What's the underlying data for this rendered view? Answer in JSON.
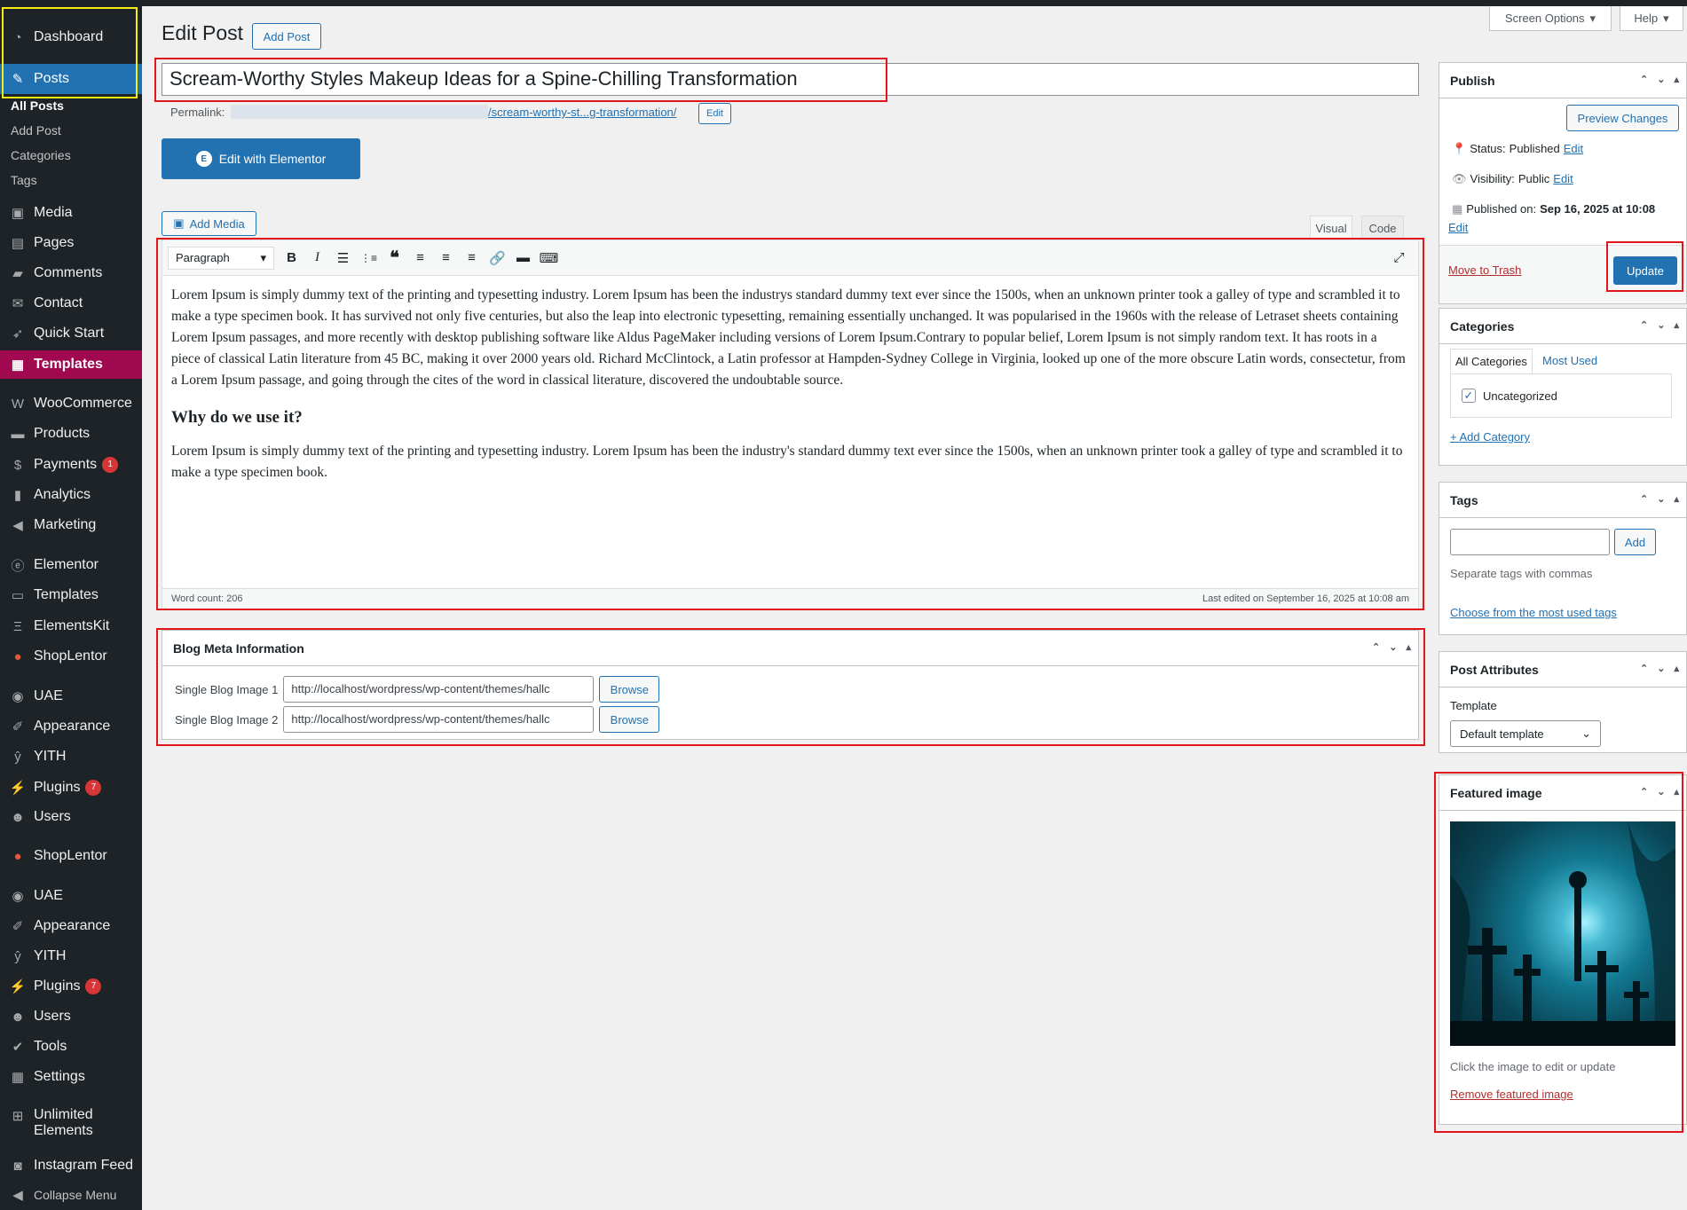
{
  "sidebar": {
    "items": [
      {
        "label": "Dashboard",
        "icon": "dashboard-icon"
      },
      {
        "label": "Posts",
        "icon": "pin-icon"
      },
      {
        "label": "Media",
        "icon": "media-icon"
      },
      {
        "label": "Pages",
        "icon": "pages-icon"
      },
      {
        "label": "Comments",
        "icon": "comments-icon"
      },
      {
        "label": "Contact",
        "icon": "mail-icon"
      },
      {
        "label": "Quick Start",
        "icon": "rocket-icon"
      },
      {
        "label": "Templates",
        "icon": "templates-icon"
      },
      {
        "label": "WooCommerce",
        "icon": "woo-icon"
      },
      {
        "label": "Products",
        "icon": "products-icon"
      },
      {
        "label": "Payments",
        "icon": "payments-icon",
        "badge": "1"
      },
      {
        "label": "Analytics",
        "icon": "chart-icon"
      },
      {
        "label": "Marketing",
        "icon": "megaphone-icon"
      },
      {
        "label": "Elementor",
        "icon": "elementor-icon"
      },
      {
        "label": "Templates",
        "icon": "folder-icon"
      },
      {
        "label": "ElementsKit",
        "icon": "ekit-icon"
      },
      {
        "label": "ShopLentor",
        "icon": "shoplentor-icon"
      },
      {
        "label": "UAE",
        "icon": "uae-icon"
      },
      {
        "label": "Appearance",
        "icon": "brush-icon"
      },
      {
        "label": "YITH",
        "icon": "yith-icon"
      },
      {
        "label": "Plugins",
        "icon": "plugin-icon",
        "badge": "7"
      },
      {
        "label": "Users",
        "icon": "users-icon"
      },
      {
        "label": "ShopLentor",
        "icon": "shoplentor-icon"
      },
      {
        "label": "UAE",
        "icon": "uae-icon"
      },
      {
        "label": "Appearance",
        "icon": "brush-icon"
      },
      {
        "label": "YITH",
        "icon": "yith-icon"
      },
      {
        "label": "Plugins",
        "icon": "plugin-icon",
        "badge": "7"
      },
      {
        "label": "Users",
        "icon": "users-icon"
      },
      {
        "label": "Tools",
        "icon": "wrench-icon"
      },
      {
        "label": "Settings",
        "icon": "settings-icon"
      },
      {
        "label": "Unlimited Elements",
        "icon": "ue-icon"
      },
      {
        "label": "Instagram Feed",
        "icon": "camera-icon"
      },
      {
        "label": "Collapse Menu",
        "icon": "collapse-icon"
      }
    ],
    "posts_submenu": [
      "All Posts",
      "Add Post",
      "Categories",
      "Tags"
    ]
  },
  "header": {
    "title": "Edit Post",
    "add_post": "Add Post",
    "screen_options": "Screen Options",
    "help": "Help"
  },
  "post": {
    "title": "Scream-Worthy Styles Makeup Ideas for a Spine-Chilling Transformation",
    "permalink_label": "Permalink:",
    "permalink_slug": "/scream-worthy-st...g-transformation/",
    "permalink_edit": "Edit",
    "elementor_button": "Edit with Elementor"
  },
  "editor": {
    "add_media": "Add Media",
    "tab_visual": "Visual",
    "tab_code": "Code",
    "format_select": "Paragraph",
    "paragraph1": "Lorem Ipsum is simply dummy text of the printing and typesetting industry. Lorem Ipsum has been the industrys standard dummy text ever since the 1500s, when an unknown printer took a galley of type and scrambled it to make a type specimen book. It has survived not only five centuries, but also the leap into electronic typesetting, remaining essentially unchanged. It was popularised in the 1960s with the release of Letraset sheets containing Lorem Ipsum passages, and more recently with desktop publishing software like Aldus PageMaker including versions of Lorem Ipsum.Contrary to popular belief, Lorem Ipsum is not simply random text. It has roots in a piece of classical Latin literature from 45 BC, making it over 2000 years old. Richard McClintock, a Latin professor at Hampden-Sydney College in Virginia, looked up one of the more obscure Latin words, consectetur, from a Lorem Ipsum passage, and going through the cites of the word in classical literature, discovered the undoubtable source.",
    "heading": "Why do we use it?",
    "paragraph2": "Lorem Ipsum is simply dummy text of the printing and typesetting industry. Lorem Ipsum has been the industry's standard dummy text ever since the 1500s, when an unknown printer took a galley of type and scrambled it to make a type specimen book.",
    "word_count": "Word count: 206",
    "last_edited": "Last edited on September 16, 2025 at 10:08 am"
  },
  "blog_meta": {
    "title": "Blog Meta Information",
    "rows": [
      {
        "label": "Single Blog Image 1",
        "value": "http://localhost/wordpress/wp-content/themes/hallc",
        "button": "Browse"
      },
      {
        "label": "Single Blog Image 2",
        "value": "http://localhost/wordpress/wp-content/themes/hallc",
        "button": "Browse"
      }
    ]
  },
  "publish": {
    "title": "Publish",
    "preview": "Preview Changes",
    "status_label": "Status:",
    "status_value": "Published",
    "visibility_label": "Visibility:",
    "visibility_value": "Public",
    "published_label": "Published on:",
    "published_value": "Sep 16, 2025 at 10:08",
    "edit": "Edit",
    "trash": "Move to Trash",
    "update": "Update"
  },
  "categories": {
    "title": "Categories",
    "tab_all": "All Categories",
    "tab_used": "Most Used",
    "items": [
      "Uncategorized"
    ],
    "add": "+ Add Category"
  },
  "tags": {
    "title": "Tags",
    "add": "Add",
    "hint": "Separate tags with commas",
    "choose": "Choose from the most used tags"
  },
  "attributes": {
    "title": "Post Attributes",
    "template_label": "Template",
    "template_value": "Default template"
  },
  "featured": {
    "title": "Featured image",
    "hint": "Click the image to edit or update",
    "remove": "Remove featured image"
  },
  "colors": {
    "accent": "#2271b1",
    "sidebar": "#1d2327",
    "highlight_red": "#e0161c",
    "highlight_yellow": "#f5ec12",
    "templates_menu": "#a0094f"
  }
}
